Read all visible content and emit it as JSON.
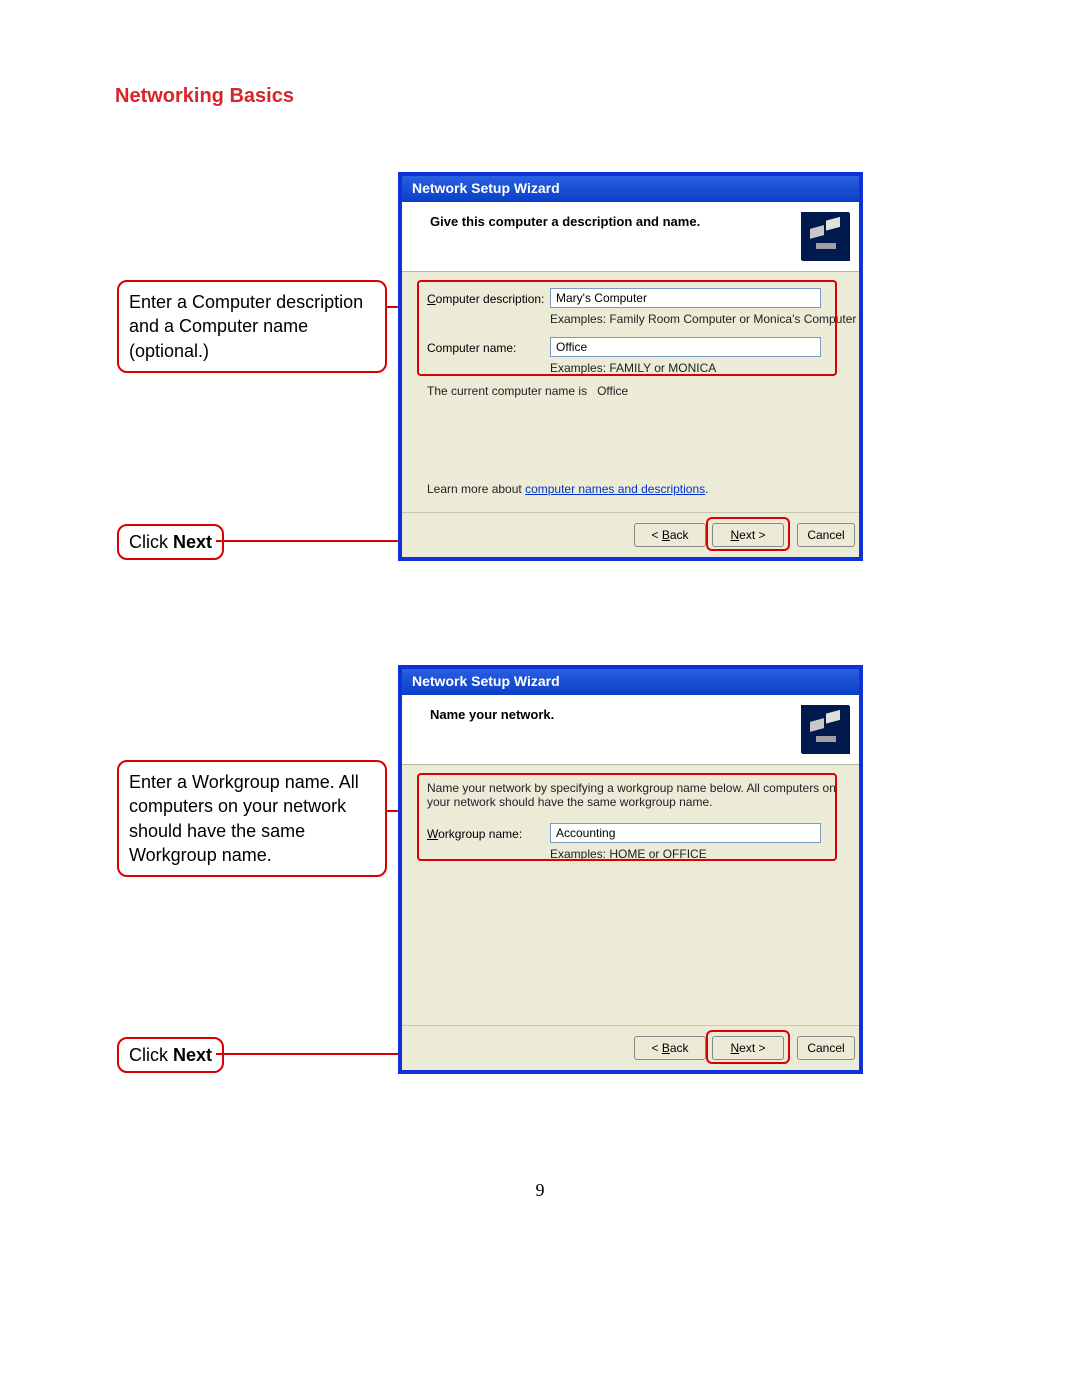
{
  "page_title": "Networking Basics",
  "page_number": "9",
  "callout1": "Enter a Computer description and a Computer name (optional.)",
  "callout2_prefix": "Click ",
  "callout2_bold": "Next",
  "callout3": "Enter a Workgroup name. All computers on your network should have the same Workgroup name.",
  "callout4_prefix": "Click ",
  "callout4_bold": "Next",
  "wizard1": {
    "title": "Network Setup Wizard",
    "header": "Give this computer a description and name.",
    "desc_label_ul": "C",
    "desc_label_rest": "omputer description:",
    "desc_value": "Mary's Computer",
    "desc_example": "Examples: Family Room Computer or Monica's Computer",
    "name_label": "Computer name:",
    "name_value": "Office",
    "name_example": "Examples: FAMILY or MONICA",
    "current_prefix": "The current computer name is ",
    "current_value": "Office",
    "learn_prefix": "Learn more about ",
    "learn_link": "computer names and descriptions",
    "back_btn": "< Back",
    "next_btn_ul": "N",
    "next_btn_rest": "ext >",
    "cancel_btn": "Cancel"
  },
  "wizard2": {
    "title": "Network Setup Wizard",
    "header": "Name your network.",
    "intro": "Name your network by specifying a workgroup name below. All computers on your network should have the same workgroup name.",
    "wg_label_ul": "W",
    "wg_label_rest": "orkgroup name:",
    "wg_value": "Accounting",
    "wg_example": "Examples: HOME or OFFICE",
    "back_btn": "< Back",
    "next_btn_ul": "N",
    "next_btn_rest": "ext >",
    "cancel_btn": "Cancel"
  }
}
